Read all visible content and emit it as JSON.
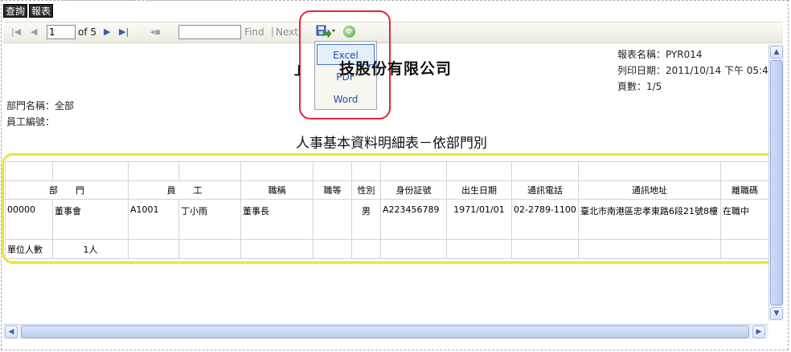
{
  "tabs": [
    "查詢",
    "報表"
  ],
  "toolbar": {
    "page_value": "1",
    "of_label": "of 5",
    "find_label": "Find",
    "separator": "|",
    "next_label": "Next"
  },
  "export_menu": {
    "items": [
      "Excel",
      "PDF",
      "Word"
    ],
    "selected": "Excel"
  },
  "report": {
    "company_name": "技股份有限公司",
    "company_prefix_fragment": "」",
    "report_name": "報表名稱：PYR014",
    "print_date": "列印日期：2011/10/14 下午 05:4",
    "page_count": "頁數：1/5",
    "department": "部門名稱：全部",
    "employee_no": "員工編號：",
    "title": "人事基本資料明細表－依部門別"
  },
  "table": {
    "headers": [
      "部　　門",
      "",
      "員　　工",
      "",
      "職稱",
      "職等",
      "性別",
      "身份証號",
      "出生日期",
      "通訊電話",
      "通訊地址",
      "離職碼"
    ],
    "row": [
      "00000",
      "董事會",
      "A1001",
      "丁小雨",
      "董事長",
      "",
      "男",
      "A223456789",
      "1971/01/01",
      "02-2789-1100",
      "臺北市南港區忠孝東路6段21號8樓",
      "在職中"
    ],
    "footer_label": "單位人數",
    "footer_value": "1人"
  }
}
